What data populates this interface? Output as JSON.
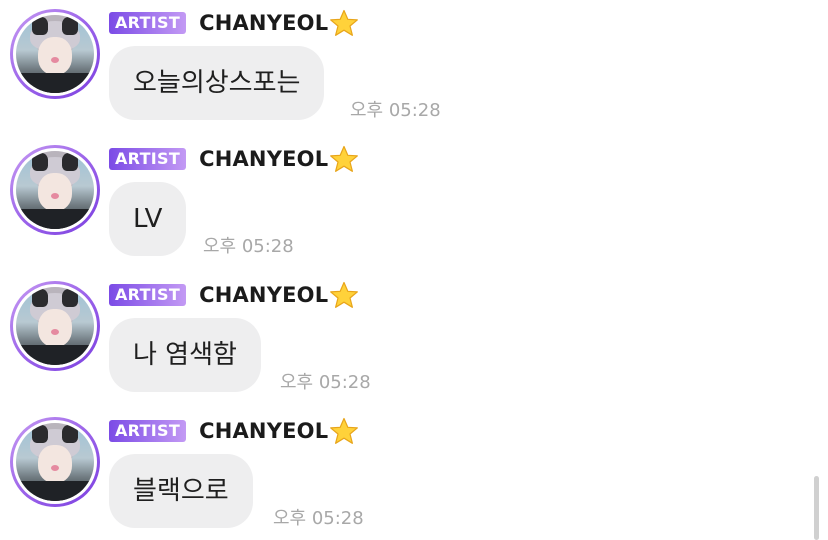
{
  "chat": {
    "messages": [
      {
        "badge": "ARTIST",
        "sender": "CHANYEOL",
        "text": "오늘의상스포는",
        "time": "오후 05:28"
      },
      {
        "badge": "ARTIST",
        "sender": "CHANYEOL",
        "text": "LV",
        "time": "오후 05:28"
      },
      {
        "badge": "ARTIST",
        "sender": "CHANYEOL",
        "text": "나 염색함",
        "time": "오후 05:28"
      },
      {
        "badge": "ARTIST",
        "sender": "CHANYEOL",
        "text": "블랙으로",
        "time": "오후 05:28"
      }
    ]
  },
  "icons": {
    "sender_emoji": "star-icon",
    "accent": "#8a55e8",
    "bubble_bg": "#eeeeef",
    "time_color": "#a8a8a8"
  }
}
